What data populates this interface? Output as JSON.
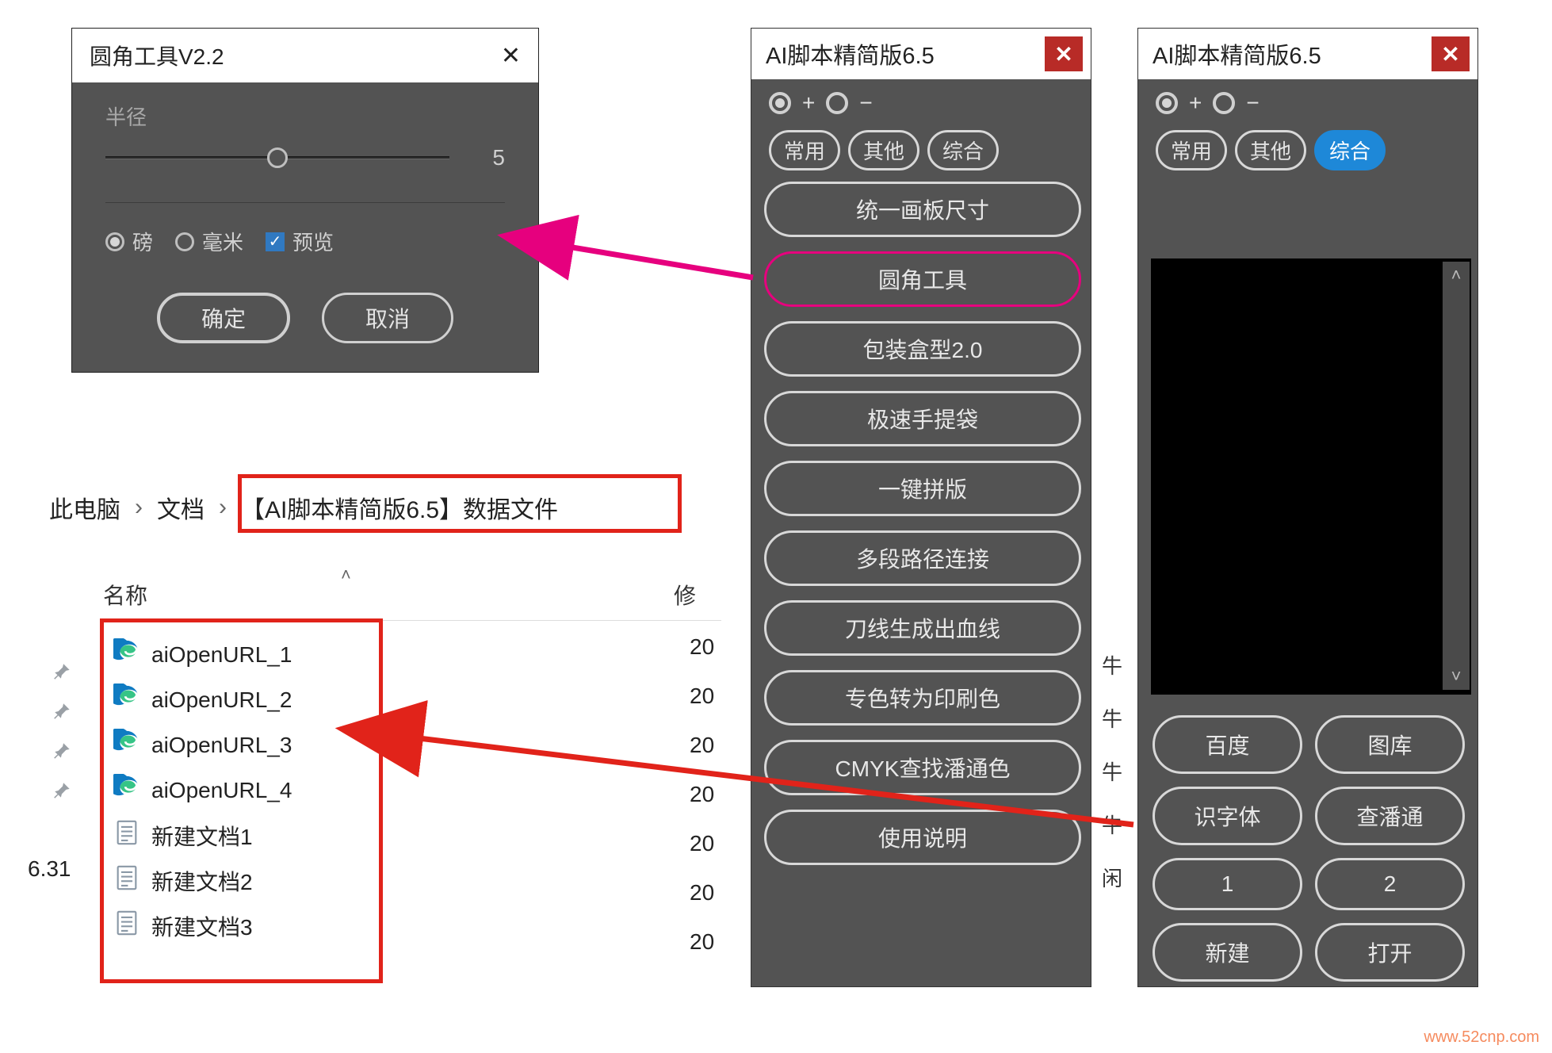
{
  "dialog": {
    "title": "圆角工具V2.2",
    "radius_label": "半径",
    "radius_value": "5",
    "unit_point": "磅",
    "unit_mm": "毫米",
    "preview": "预览",
    "ok": "确定",
    "cancel": "取消"
  },
  "breadcrumb": {
    "root": "此电脑",
    "docs": "文档",
    "folder": "【AI脚本精简版6.5】数据文件"
  },
  "explorer": {
    "col_name": "名称",
    "col_mod": "修",
    "version_fragment": "6.31",
    "files": [
      {
        "name": "aiOpenURL_1",
        "type": "edge",
        "mod": "20"
      },
      {
        "name": "aiOpenURL_2",
        "type": "edge",
        "mod": "20"
      },
      {
        "name": "aiOpenURL_3",
        "type": "edge",
        "mod": "20"
      },
      {
        "name": "aiOpenURL_4",
        "type": "edge",
        "mod": "20"
      },
      {
        "name": "新建文档1",
        "type": "txt",
        "mod": "20"
      },
      {
        "name": "新建文档2",
        "type": "txt",
        "mod": "20"
      },
      {
        "name": "新建文档3",
        "type": "txt",
        "mod": "20"
      }
    ]
  },
  "panel": {
    "title": "AI脚本精简版6.5",
    "plus": "+",
    "minus": "−",
    "tabs": {
      "common": "常用",
      "other": "其他",
      "comp": "综合"
    },
    "left_buttons": [
      "统一画板尺寸",
      "圆角工具",
      "包装盒型2.0",
      "极速手提袋",
      "一键拼版",
      "多段路径连接",
      "刀线生成出血线",
      "专色转为印刷色",
      "CMYK查找潘通色",
      "使用说明"
    ],
    "right_grid": [
      "百度",
      "图库",
      "识字体",
      "查潘通",
      "1",
      "2",
      "新建",
      "打开"
    ],
    "key_frags": [
      "牛",
      "牛",
      "牛",
      "牛",
      "闲"
    ]
  },
  "watermark": "www.52cnp.com",
  "colors": {
    "magenta": "#e6007e",
    "red": "#e1231a",
    "close": "#b82b27",
    "blue_tab": "#1e88d8"
  }
}
